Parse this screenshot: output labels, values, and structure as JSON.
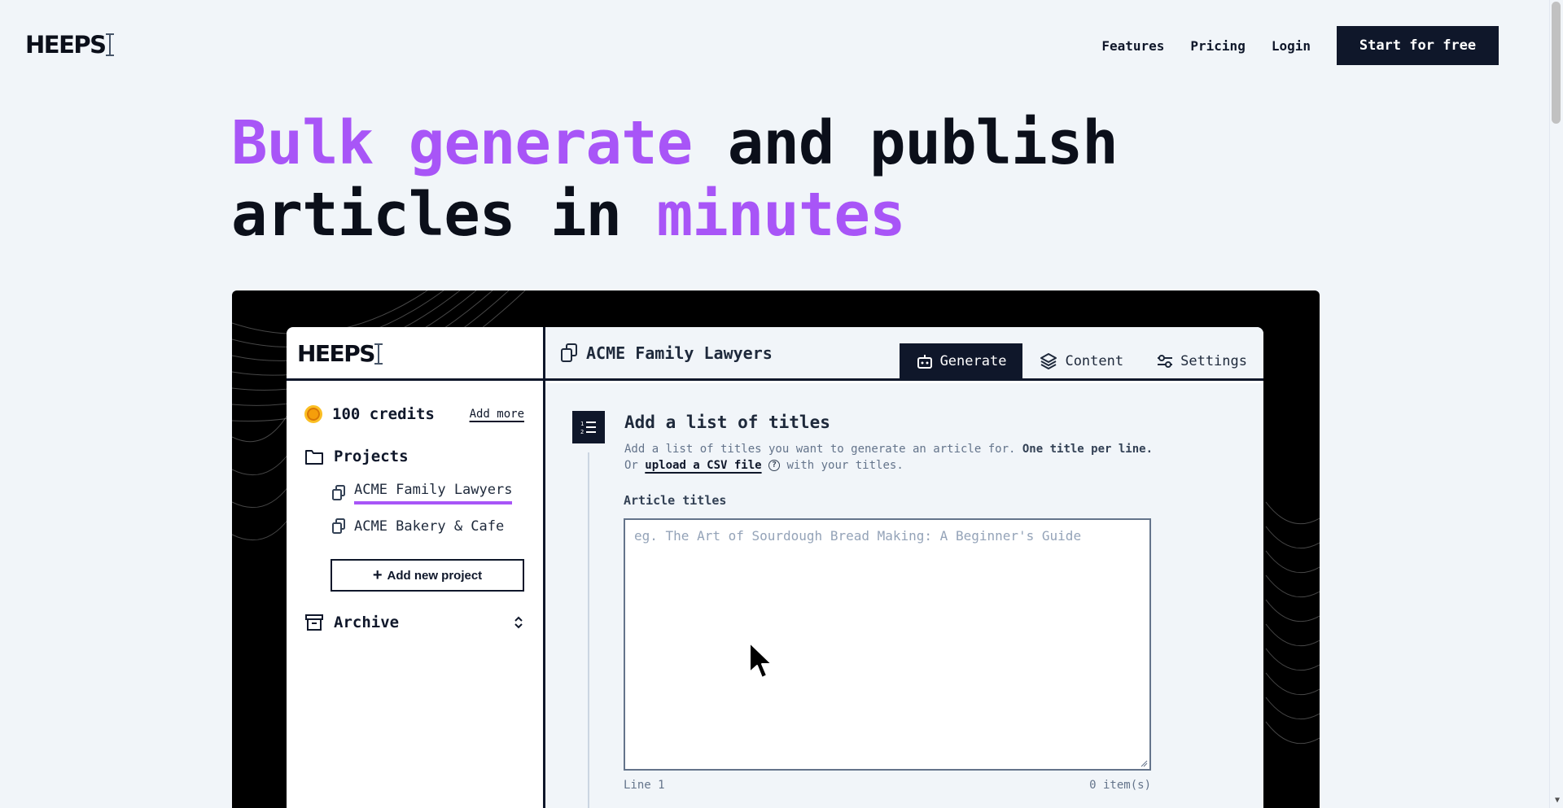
{
  "brand": {
    "logo": "HEEPS"
  },
  "nav": {
    "features": "Features",
    "pricing": "Pricing",
    "login": "Login",
    "cta": "Start for free"
  },
  "hero": {
    "w1": "Bulk",
    "w2": "generate",
    "w3": "and publish",
    "w4": "articles in",
    "w5": "minutes"
  },
  "app": {
    "logo": "HEEPS",
    "credits": "100 credits",
    "add_more": "Add more",
    "projects_label": "Projects",
    "projects": [
      {
        "label": "ACME Family Lawyers",
        "active": true
      },
      {
        "label": "ACME Bakery & Cafe",
        "active": false
      }
    ],
    "add_project": "Add new project",
    "archive_label": "Archive",
    "project_title": "ACME Family Lawyers",
    "tabs": [
      {
        "label": "Generate",
        "icon": "robot-icon",
        "active": true
      },
      {
        "label": "Content",
        "icon": "layers-icon",
        "active": false
      },
      {
        "label": "Settings",
        "icon": "sliders-icon",
        "active": false
      }
    ],
    "step_title": "Add a list of titles",
    "desc_part1": "Add a list of titles you want to generate an article for.",
    "desc_bold": "One title per line.",
    "desc_or": "Or",
    "desc_link": "upload a CSV file",
    "desc_end": "with your titles.",
    "field_label": "Article titles",
    "field_placeholder": "eg. The Art of Sourdough Bread Making: A Beginner's Guide",
    "field_value": "",
    "line_count": "Line 1",
    "item_count": "0 item(s)"
  },
  "colors": {
    "accent": "#a855f7",
    "dark": "#0f172a",
    "background": "#f1f5f9"
  }
}
